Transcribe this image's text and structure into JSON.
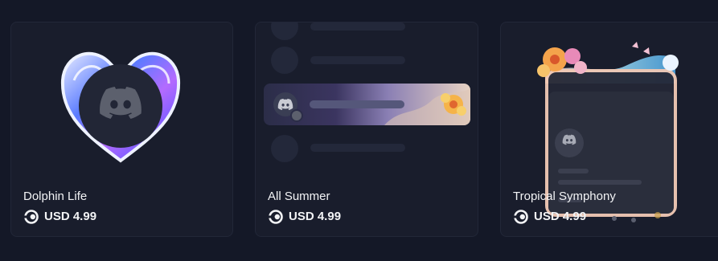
{
  "products": [
    {
      "name": "Dolphin Life",
      "price": "USD 4.99",
      "preview": "heart-avatar-decoration"
    },
    {
      "name": "All Summer",
      "price": "USD 4.99",
      "preview": "summer-nameplate"
    },
    {
      "name": "Tropical Symphony",
      "price": "USD 4.99",
      "preview": "tropical-profile-effect"
    }
  ],
  "price_icon": "orb-icon",
  "colors": {
    "background": "#141827",
    "card": "#191d2c",
    "border": "#222738",
    "text": "#f2f3f5"
  }
}
